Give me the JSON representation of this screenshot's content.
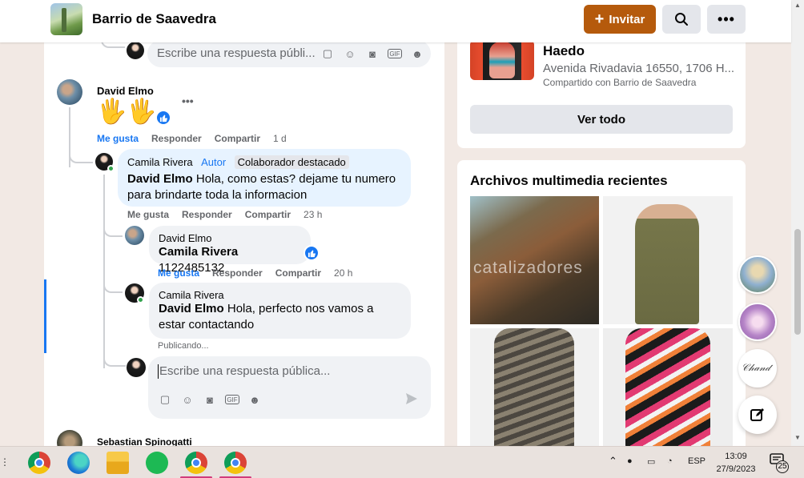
{
  "header": {
    "group_name": "Barrio de Saavedra",
    "invite_label": "Invitar"
  },
  "feed": {
    "reply_placeholder_top": "Escribe una respuesta públi...",
    "comment": {
      "author": "David Elmo",
      "emoji": "🖐🖐",
      "like": "Me gusta",
      "reply": "Responder",
      "share": "Compartir",
      "time": "1 d"
    },
    "reply1": {
      "author": "Camila Rivera",
      "author_tag": "Autor",
      "featured_tag": "Colaborador destacado",
      "mention": "David Elmo",
      "text": " Hola, como estas? dejame tu numero para brindarte toda la informacion",
      "like": "Me gusta",
      "reply": "Responder",
      "share": "Compartir",
      "time": "23 h"
    },
    "reply2": {
      "author": "David Elmo",
      "mention": "Camila Rivera",
      "text": " 1122485132",
      "like": "Me gusta",
      "reply": "Responder",
      "share": "Compartir",
      "time": "20 h"
    },
    "reply3": {
      "author": "Camila Rivera",
      "mention": "David Elmo",
      "text": " Hola, perfecto nos vamos a estar contactando",
      "status": "Publicando..."
    },
    "reply_placeholder_bottom": "Escribe una respuesta pública...",
    "next_comment_author": "Sebastian Spinogatti"
  },
  "event_card": {
    "title": "Haedo",
    "address": "Avenida Rivadavia 16550, 1706 H...",
    "shared": "Compartido con Barrio de Saavedra",
    "see_all": "Ver todo"
  },
  "media": {
    "title": "Archivos multimedia recientes",
    "watermark": "catalizadores"
  },
  "taskbar": {
    "lang": "ESP",
    "time": "13:09",
    "date": "27/9/2023",
    "notif_count": "25"
  }
}
